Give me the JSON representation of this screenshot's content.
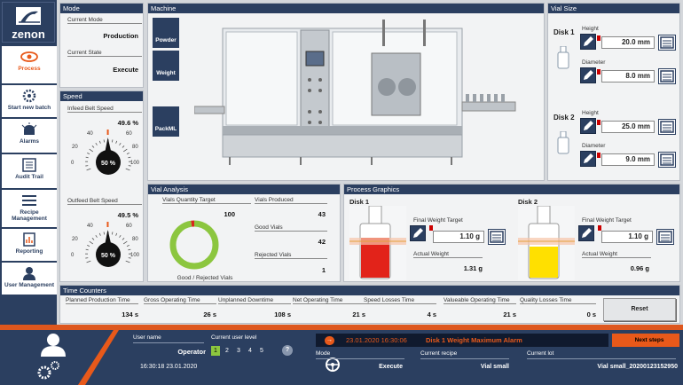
{
  "sidebar": {
    "items": [
      {
        "label": "Process",
        "icon": "eye-icon"
      },
      {
        "label": "Start new batch",
        "icon": "gear-icon"
      },
      {
        "label": "Alarms",
        "icon": "alarm-icon"
      },
      {
        "label": "Audit Trail",
        "icon": "audit-icon"
      },
      {
        "label": "Recipe Management",
        "icon": "recipe-icon"
      },
      {
        "label": "Reporting",
        "icon": "reporting-icon"
      },
      {
        "label": "User Management",
        "icon": "user-icon"
      }
    ]
  },
  "mode": {
    "title": "Mode",
    "current_mode_label": "Current Mode",
    "current_mode": "Production",
    "current_state_label": "Current State",
    "current_state": "Execute"
  },
  "speed": {
    "title": "Speed",
    "infeed_label": "Infeed Belt Speed",
    "infeed_value": "49.6 %",
    "infeed_gauge": "50 %",
    "outfeed_label": "Outfeed Belt Speed",
    "outfeed_value": "49.5 %",
    "outfeed_gauge": "50 %",
    "gauge_ticks": [
      "0",
      "20",
      "40",
      "60",
      "80",
      "100"
    ],
    "infeed_level": 0.496,
    "outfeed_level": 0.495
  },
  "machine": {
    "title": "Machine",
    "powder": "Powder",
    "weight": "Weight",
    "packml": "PackML"
  },
  "vial_size": {
    "title": "Vial Size",
    "disk1": "Disk 1",
    "disk2": "Disk 2",
    "height_label": "Height",
    "diameter_label": "Diameter",
    "d1_height": "20.0 mm",
    "d1_diameter": "8.0 mm",
    "d2_height": "25.0 mm",
    "d2_diameter": "9.0 mm"
  },
  "vial_analysis": {
    "title": "Vial Analysis",
    "qty_target_label": "Vials Quantity Target",
    "qty_target": "100",
    "produced_label": "Vials Produced",
    "produced": "43",
    "good_label": "Good Vials",
    "good": "42",
    "rejected_label": "Rejected Vials",
    "rejected": "1",
    "donut_label": "Good / Rejected Vials",
    "good_count": 42,
    "rejected_count": 1,
    "good_color": "#8cc63f",
    "rejected_color": "#d9261c"
  },
  "process_graphics": {
    "title": "Process Graphics",
    "disk1": "Disk 1",
    "disk2": "Disk 2",
    "final_target_label": "Final Weight Target",
    "actual_label": "Actual Weight",
    "d1_target": "1.10 g",
    "d1_actual": "1.31 g",
    "d2_target": "1.10 g",
    "d2_actual": "0.96 g",
    "d1_color": "#e2231a",
    "d2_color": "#ffe000"
  },
  "time_counters": {
    "title": "Time Counters",
    "items": [
      {
        "label": "Planned Production Time",
        "value": "134 s"
      },
      {
        "label": "Gross Operating Time",
        "value": "26 s"
      },
      {
        "label": "Unplanned Downtime",
        "value": "108 s"
      },
      {
        "label": "Net Operating Time",
        "value": "21 s"
      },
      {
        "label": "Speed Losses Time",
        "value": "4 s"
      },
      {
        "label": "Valueable Operating Time",
        "value": "21 s"
      },
      {
        "label": "Quality Losses Time",
        "value": "0 s"
      }
    ],
    "reset": "Reset"
  },
  "footer": {
    "username_label": "User name",
    "username": "Operator",
    "level_label": "Current user level",
    "levels": [
      "1",
      "2",
      "3",
      "4",
      "5"
    ],
    "help": "?",
    "datetime": "16:30:18 23.01.2020",
    "alarm_time": "23.01.2020 16:30:06",
    "alarm_text": "Disk 1 Weight Maximum Alarm",
    "next_steps": "Next steps",
    "mode_label": "Mode",
    "mode": "Execute",
    "recipe_label": "Current recipe",
    "recipe": "Vial small",
    "lot_label": "Current lot",
    "lot": "Vial small_20200123152950"
  },
  "logo": "zenon"
}
